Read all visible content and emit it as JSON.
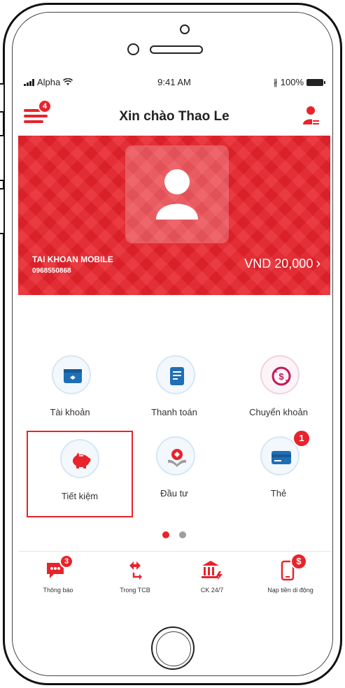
{
  "status_bar": {
    "carrier": "Alpha",
    "time": "9:41 AM",
    "battery": "100%"
  },
  "header": {
    "greeting": "Xin chào Thao Le",
    "menu_badge": "4"
  },
  "account": {
    "name": "TAI KHOAN MOBILE",
    "number": "0968550868",
    "balance": "VND 20,000"
  },
  "features": [
    {
      "label": "Tài khoản",
      "icon": "wallet-icon"
    },
    {
      "label": "Thanh toán",
      "icon": "receipt-icon"
    },
    {
      "label": "Chuyển khoản",
      "icon": "transfer-icon"
    },
    {
      "label": "Tiết kiệm",
      "icon": "piggy-bank-icon",
      "selected": true
    },
    {
      "label": "Đầu tư",
      "icon": "invest-icon"
    },
    {
      "label": "Thẻ",
      "icon": "card-icon",
      "badge": "1"
    }
  ],
  "pager": {
    "pages": 2,
    "active": 0
  },
  "tabbar": [
    {
      "label": "Thông báo",
      "icon": "chat-icon",
      "badge": "3"
    },
    {
      "label": "Trong TCB",
      "icon": "transfer-arrows-icon"
    },
    {
      "label": "CK 24/7",
      "icon": "bank-icon"
    },
    {
      "label": "Nạp tiền di động",
      "icon": "phone-topup-icon",
      "badge": "$"
    }
  ],
  "colors": {
    "brand": "#e8232b",
    "icon_blue": "#1f6fb5",
    "icon_purple": "#c2185b",
    "dot_inactive": "#9e9e9e"
  }
}
